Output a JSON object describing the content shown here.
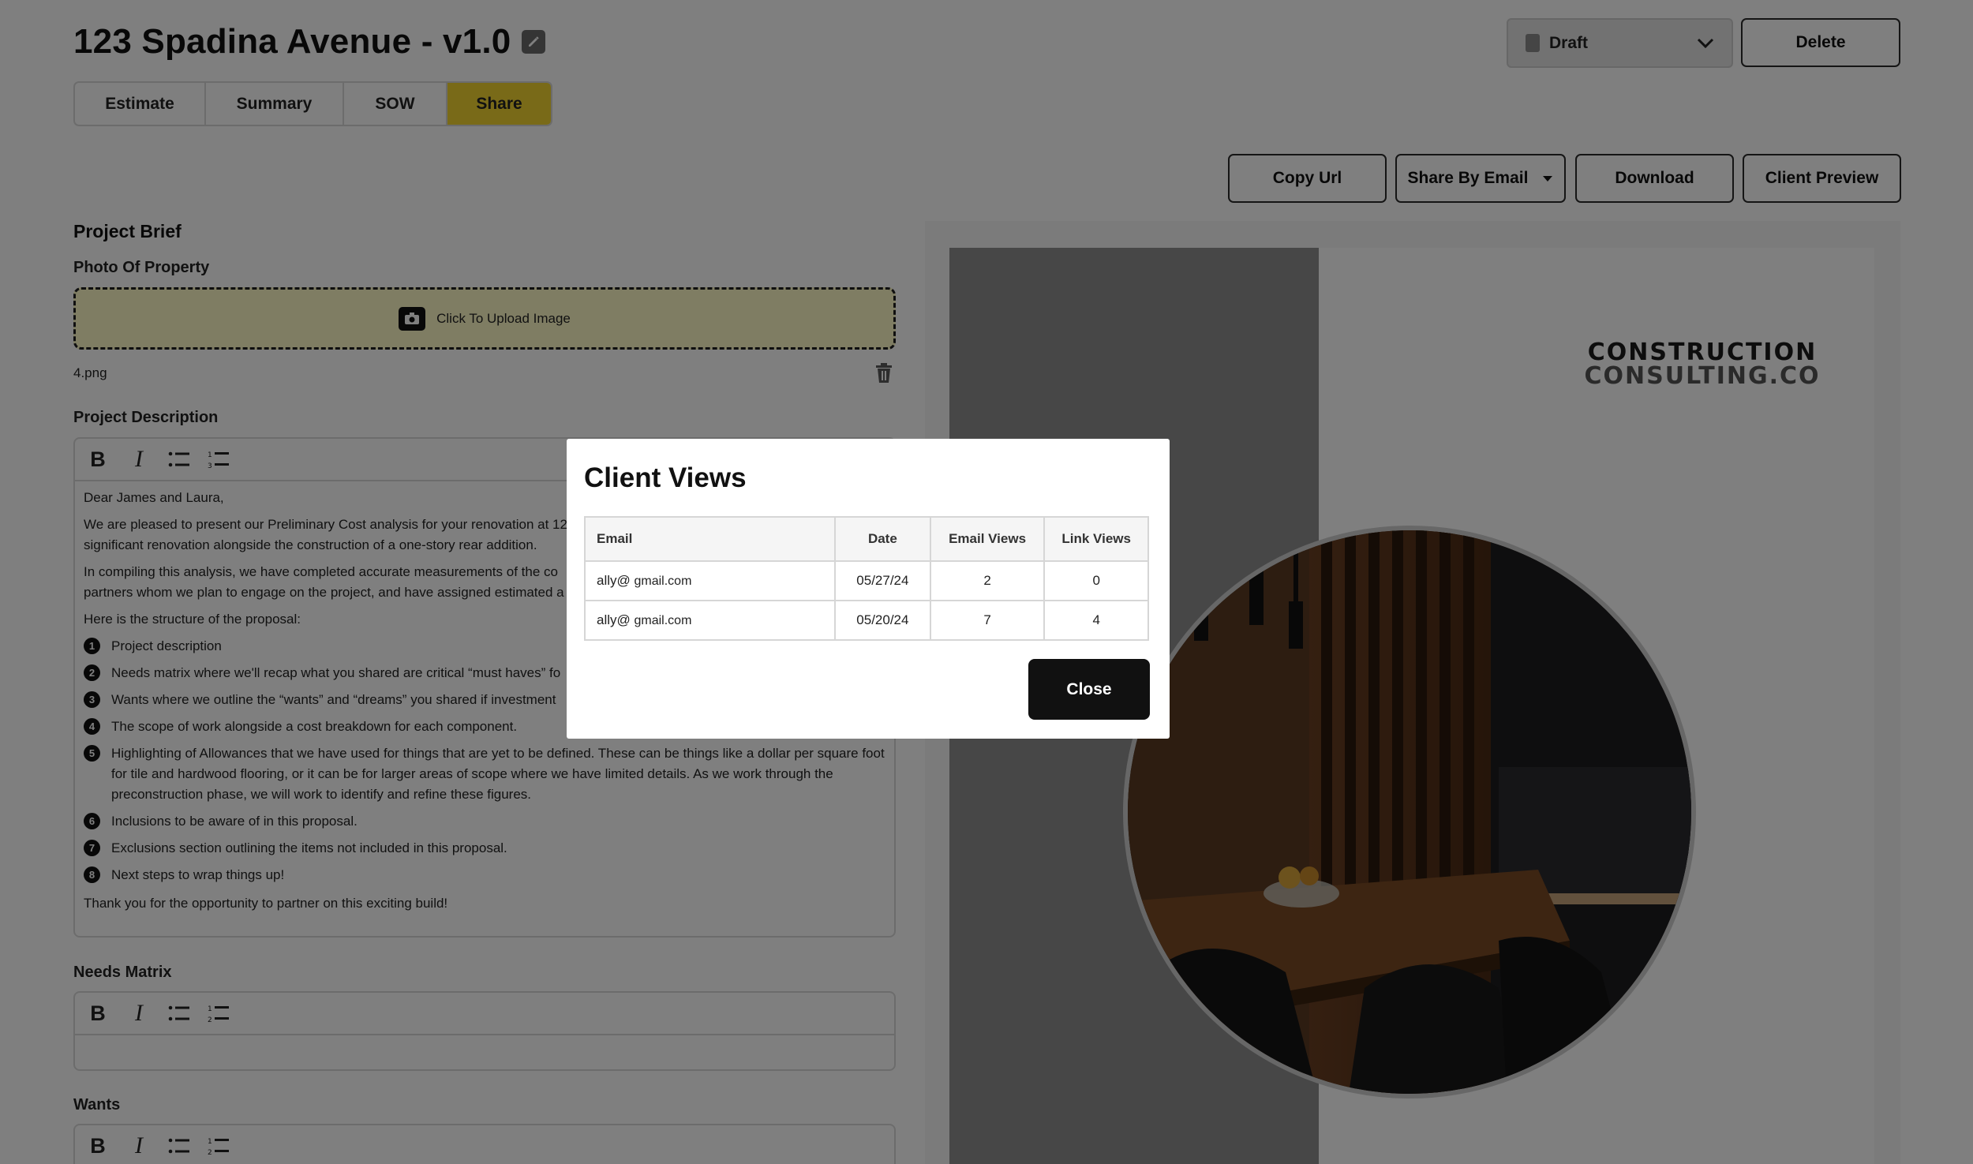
{
  "header": {
    "title": "123 Spadina Avenue - v1.0",
    "status": "Draft",
    "delete_label": "Delete"
  },
  "tabs": [
    {
      "label": "Estimate",
      "active": false
    },
    {
      "label": "Summary",
      "active": false
    },
    {
      "label": "SOW",
      "active": false
    },
    {
      "label": "Share",
      "active": true
    }
  ],
  "share_actions": {
    "copy_url": "Copy Url",
    "share_by_email": "Share By Email",
    "download": "Download",
    "client_preview": "Client Preview"
  },
  "project_brief": {
    "title": "Project Brief",
    "photo_label": "Photo Of Property",
    "upload_text": "Click To Upload Image",
    "file_name": "4.png",
    "description_label": "Project Description",
    "description": {
      "greeting": "Dear James and Laura,",
      "para1": "We are pleased to present our Preliminary Cost analysis for your renovation at 12",
      "para1b": "significant renovation alongside the construction of a one-story rear addition.",
      "para2": "In compiling this analysis, we have completed accurate measurements of the co",
      "para2b": "partners whom we plan to engage on the project, and have assigned estimated a",
      "para3": "Here is the structure of the proposal:",
      "items": [
        {
          "num": "1",
          "text": "Project description"
        },
        {
          "num": "2",
          "text": "Needs matrix where we'll recap what you shared are critical “must haves” fo"
        },
        {
          "num": "3",
          "text": "Wants where we outline the “wants” and “dreams” you shared if investment"
        },
        {
          "num": "4",
          "text": "The scope of work alongside a cost breakdown for each component."
        },
        {
          "num": "5",
          "text": "Highlighting of Allowances that we have used for things that are yet to be defined. These can be things like a dollar per square foot for tile and hardwood flooring, or it can be for larger areas of scope where we have limited details. As we work through the preconstruction phase, we will work to identify and refine these figures."
        },
        {
          "num": "6",
          "text": "Inclusions to be aware of in this proposal."
        },
        {
          "num": "7",
          "text": "Exclusions section outlining the items not included in this proposal."
        },
        {
          "num": "8",
          "text": "Next steps to wrap things up!"
        }
      ],
      "closing": "Thank you for the opportunity to partner on this exciting build!"
    },
    "needs_label": "Needs Matrix",
    "wants_label": "Wants"
  },
  "preview": {
    "brand_line1": "CONSTRUCTION",
    "brand_line2": "CONSULTING.CO"
  },
  "modal": {
    "title": "Client Views",
    "columns": [
      "Email",
      "Date",
      "Email Views",
      "Link Views"
    ],
    "rows": [
      {
        "email_user": "ally@",
        "email_domain": "gmail.com",
        "date": "05/27/24",
        "email_views": "2",
        "link_views": "0"
      },
      {
        "email_user": "ally@",
        "email_domain": "gmail.com",
        "date": "05/20/24",
        "email_views": "7",
        "link_views": "4"
      }
    ],
    "close_label": "Close"
  },
  "colors": {
    "accent": "#f2d531",
    "overlay": "rgba(0,0,0,0.5)"
  }
}
